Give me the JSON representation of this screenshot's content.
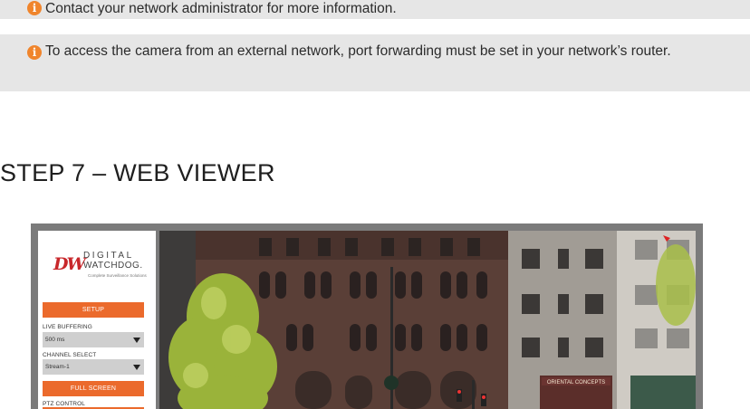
{
  "notes": [
    "Contact your network administrator for more information.",
    "To access the camera from an external network, port forwarding must be set in your network’s router."
  ],
  "info_icon_glyph": "i",
  "section_title": "STEP 7 – WEB VIEWER",
  "viewer": {
    "logo": {
      "mark": "DW",
      "line1": "DIGITAL",
      "line2": "WATCHDOG.",
      "tagline": "Complete Surveillance Solutions"
    },
    "setup_label": "SETUP",
    "live_buffering_label": "LIVE BUFFERING",
    "live_buffering_value": "500 ms",
    "channel_select_label": "CHANNEL SELECT",
    "channel_select_value": "Stream-1",
    "full_screen_label": "FULL SCREEN",
    "ptz_control_label": "PTZ CONTROL",
    "storefront_sign": "ORIENTAL CONCEPTS"
  },
  "colors": {
    "accent": "#eb6a2c",
    "note_background": "#e6e6e6",
    "viewer_frame": "#7b7b7b"
  }
}
